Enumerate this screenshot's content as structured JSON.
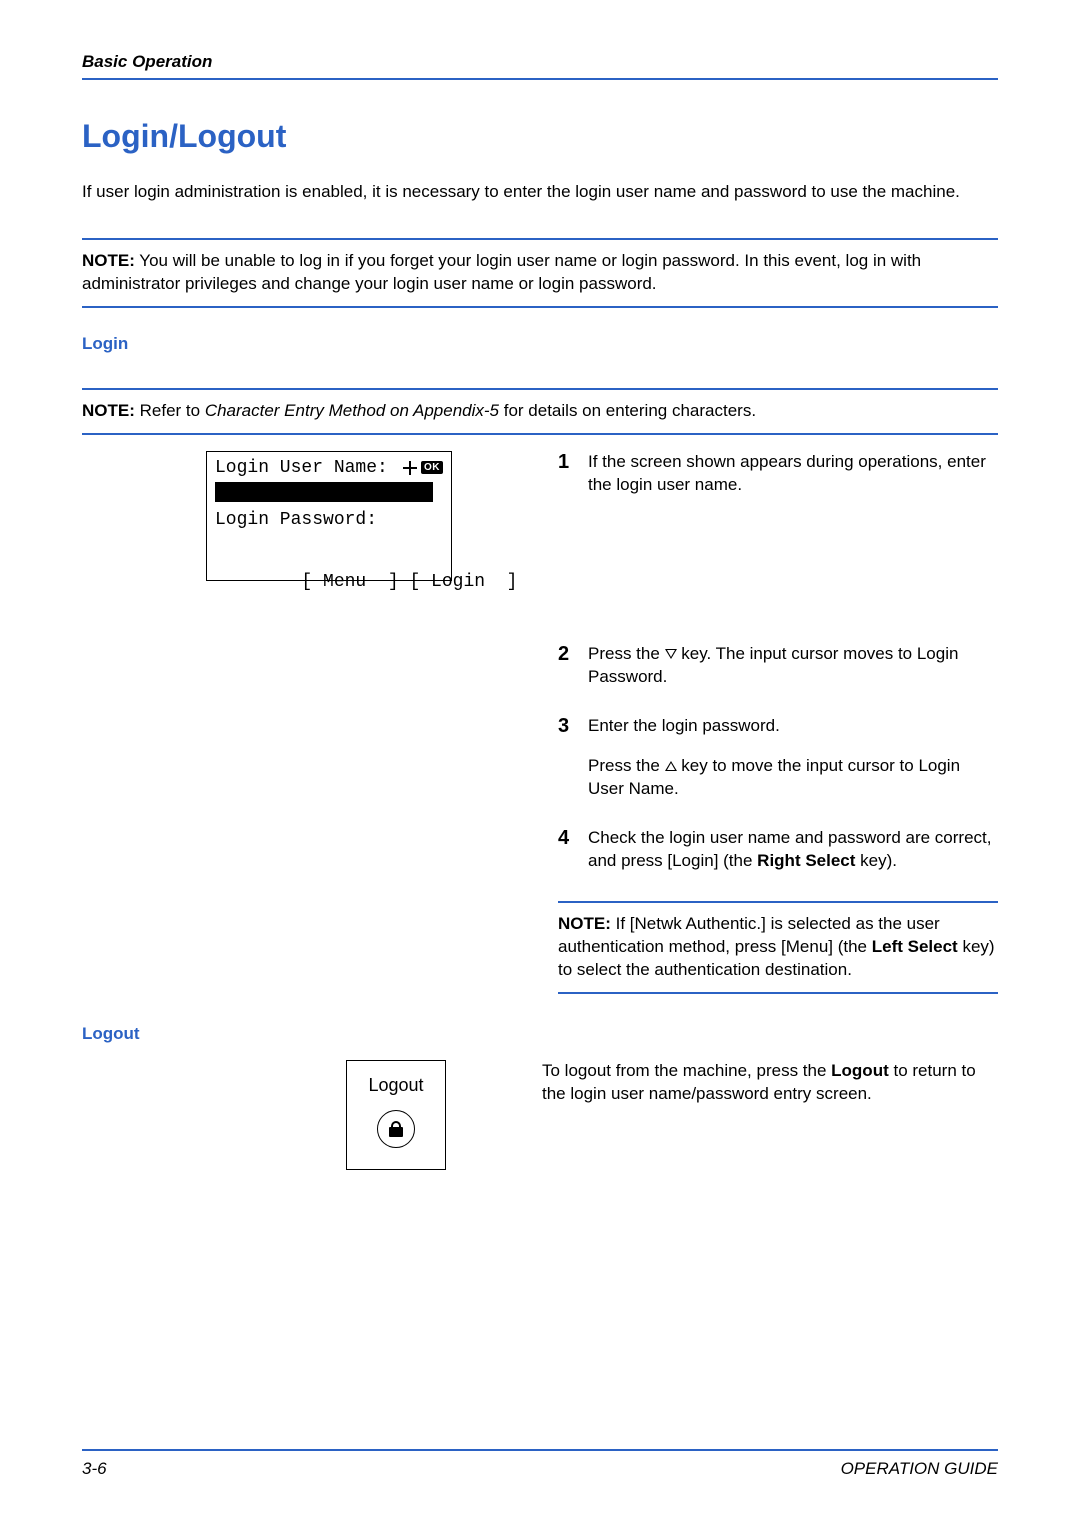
{
  "header": {
    "running_head": "Basic Operation",
    "title": "Login/Logout"
  },
  "intro": "If user login administration is enabled, it is necessary to enter the login user name and password to use the machine.",
  "note1": {
    "lead": "NOTE:",
    "body": " You will be unable to log in if you forget your login user name or login password. In this event, log in with administrator privileges and change your login user name or login password."
  },
  "login": {
    "heading": "Login",
    "note": {
      "lead": "NOTE:",
      "pre_italic": " Refer to ",
      "italic": "Character Entry Method on Appendix-5",
      "post_italic": " for details on entering characters."
    },
    "lcd": {
      "line1": "Login User Name:",
      "ok": "OK",
      "line_pass": "Login Password:",
      "soft_left": "[ Menu  ]",
      "soft_right": "[ Login  ]"
    },
    "steps": {
      "s1": {
        "n": "1",
        "t": "If the screen shown appears during operations, enter the login user name."
      },
      "s2": {
        "n": "2",
        "pre": "Press the ",
        "post": " key. The input cursor moves to Login Password."
      },
      "s3": {
        "n": "3",
        "t1": "Enter the login password.",
        "sub_pre": "Press the ",
        "sub_post": " key to move the input cursor to Login User Name."
      },
      "s4": {
        "n": "4",
        "pre": "Check the login user name and password are correct, and press [Login] (the ",
        "bold": "Right Select",
        "post": " key)."
      }
    },
    "note_inline": {
      "lead": "NOTE:",
      "pre": " If [Netwk Authentic.] is selected as the user authentication method, press [Menu] (the ",
      "bold": "Left Select",
      "post": " key) to select the authentication destination."
    }
  },
  "logout": {
    "heading": "Logout",
    "box_label": "Logout",
    "text_pre": "To logout from the machine, press the ",
    "text_bold": "Logout",
    "text_post": " to return to the login user name/password entry screen."
  },
  "footer": {
    "page_num": "3-6",
    "guide": "OPERATION GUIDE"
  }
}
